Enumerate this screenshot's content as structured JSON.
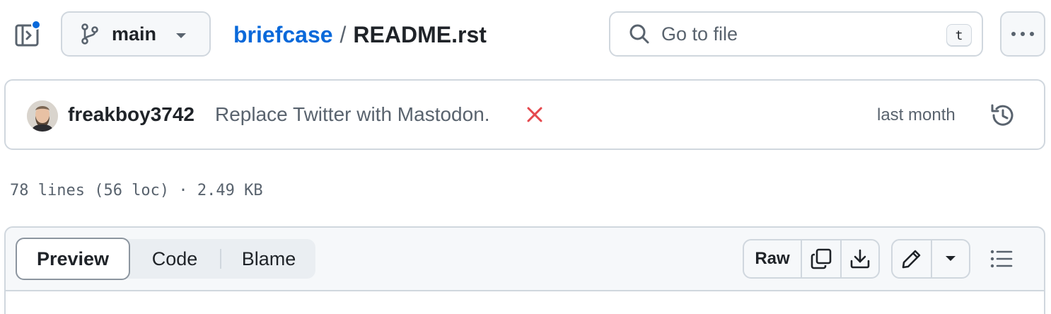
{
  "top_bar": {
    "branch": {
      "label": "main"
    },
    "breadcrumb": {
      "repo": "briefcase",
      "separator": "/",
      "file": "README.rst"
    },
    "search": {
      "placeholder": "Go to file",
      "shortcut": "t"
    }
  },
  "commit": {
    "author": "freakboy3742",
    "message": "Replace Twitter with Mastodon.",
    "status": "failed",
    "timestamp": "last month"
  },
  "file_meta": "78 lines (56 loc) · 2.49 KB",
  "file_header": {
    "tabs": [
      {
        "label": "Preview",
        "selected": true
      },
      {
        "label": "Code",
        "selected": false
      },
      {
        "label": "Blame",
        "selected": false
      }
    ],
    "raw_label": "Raw"
  },
  "colors": {
    "accent": "#0969da",
    "error": "#cf222e",
    "muted": "#59636e",
    "border": "#d0d7de"
  },
  "icons": [
    "sidebar-toggle-icon",
    "git-branch-icon",
    "chevron-down-icon",
    "search-icon",
    "kebab-horizontal-icon",
    "x-icon",
    "history-icon",
    "copy-icon",
    "download-icon",
    "pencil-icon",
    "list-unordered-icon"
  ]
}
